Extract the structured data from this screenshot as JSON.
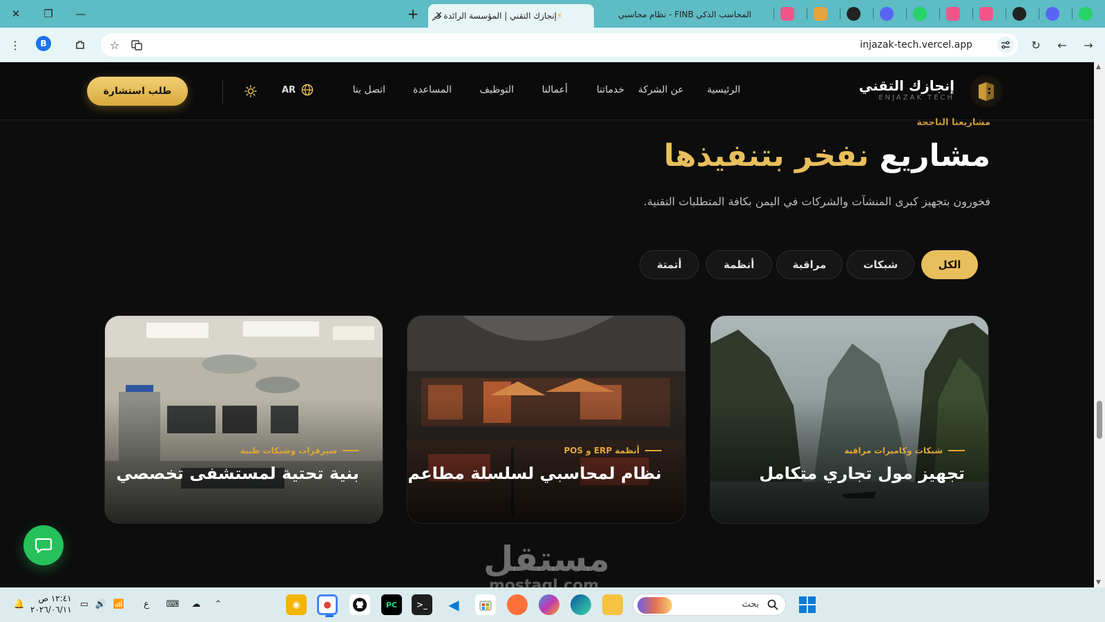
{
  "browser": {
    "active_tab": {
      "title": "إنجازك التقني | المؤسسة الرائدة في",
      "favicon": "lightning-icon"
    },
    "inactive_tab": {
      "title": "المحاسب الذكي FINB - نظام محاسبي"
    },
    "pinned_tabs": [
      "pink-app-icon",
      "colorful-app-icon",
      "github-icon",
      "discord-icon",
      "whatsapp-icon",
      "pink-app-icon",
      "pink-app-icon",
      "github-icon",
      "discord-icon",
      "whatsapp-icon"
    ],
    "url": "injazak-tech.vercel.app",
    "profile_initial": "B"
  },
  "site": {
    "logo_title": "إنجازك التقني",
    "logo_subtitle": "ENJAZAK TECH",
    "nav": [
      "الرئيسية",
      "عن الشركة",
      "خدماتنا",
      "أعمالنا",
      "التوظيف",
      "المساعدة",
      "اتصل بنا"
    ],
    "lang": "AR",
    "cta": "طلب استشارة"
  },
  "section": {
    "eyebrow": "مشاريعنا الناجحة",
    "headline_white": "مشاريع",
    "headline_gold": "نفخر بتنفيذها",
    "subtitle": "فخورون بتجهيز كبرى المنشآت والشركات في اليمن بكافة المتطلبات التقنية.",
    "filters": [
      "الكل",
      "شبكات",
      "مراقبة",
      "أنظمة",
      "أتمتة"
    ],
    "active_filter": "الكل"
  },
  "projects": [
    {
      "tag": "شبكات وكاميرات مراقبة",
      "title": "تجهيز مول تجاري متكامل"
    },
    {
      "tag": "أنظمة ERP و POS",
      "title": "نظام لمحاسبي لسلسلة مطاعم"
    },
    {
      "tag": "سيرفرات وشبكات طبية",
      "title": "بنية تحتية لمستشفى تخصصي"
    }
  ],
  "watermark": {
    "text": "مستقل",
    "sub": "mostaql.com"
  },
  "taskbar": {
    "search_placeholder": "بحث",
    "time": "١٢:٤١ ص",
    "date": "٢٠٢٦/٠٦/١١",
    "lang_indicator": "ع",
    "apps": [
      "chrome-canary-icon",
      "chrome-icon",
      "github-icon",
      "pycharm-icon",
      "terminal-icon",
      "vscode-icon",
      "store-icon",
      "firefox-icon",
      "copilot-icon",
      "edge-icon",
      "file-explorer-icon"
    ]
  },
  "colors": {
    "gold": "#e8bf5c",
    "bg": "#0d0d0d",
    "chat": "#25c15b",
    "chrome_bar": "#5dbcc4"
  }
}
